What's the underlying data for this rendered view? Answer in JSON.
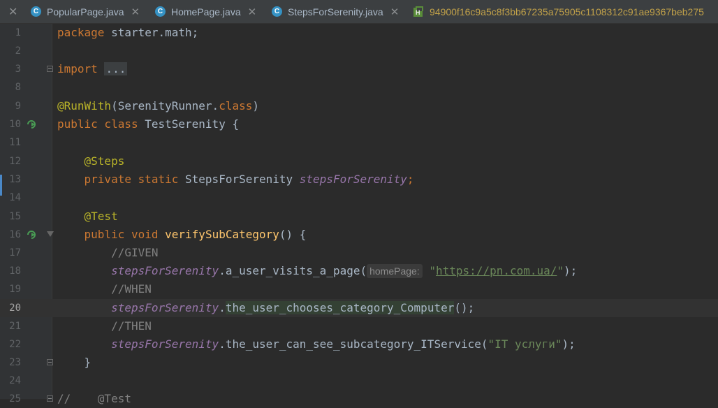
{
  "tabs": [
    {
      "label": "PopularPage.java",
      "icon": "java-class-icon"
    },
    {
      "label": "HomePage.java",
      "icon": "java-class-icon"
    },
    {
      "label": "StepsForSerenity.java",
      "icon": "java-class-icon"
    },
    {
      "label": "94900f16c9a5c8f3bb67235a75905c1108312c91ae9367beb275",
      "icon": "html-file-icon"
    }
  ],
  "editor": {
    "current_line": 20,
    "lines": [
      {
        "num": "1"
      },
      {
        "num": "2"
      },
      {
        "num": "3"
      },
      {
        "num": "8"
      },
      {
        "num": "9"
      },
      {
        "num": "10"
      },
      {
        "num": "11"
      },
      {
        "num": "12"
      },
      {
        "num": "13"
      },
      {
        "num": "14"
      },
      {
        "num": "15"
      },
      {
        "num": "16"
      },
      {
        "num": "17"
      },
      {
        "num": "18"
      },
      {
        "num": "19"
      },
      {
        "num": "20"
      },
      {
        "num": "21"
      },
      {
        "num": "22"
      },
      {
        "num": "23"
      },
      {
        "num": "24"
      },
      {
        "num": "25"
      }
    ],
    "code": {
      "l1_kw": "package",
      "l1_rest": " starter.math;",
      "l3_kw": "import",
      "l3_ellipsis": "...",
      "l9_ann": "@RunWith",
      "l9_open": "(SerenityRunner.",
      "l9_class": "class",
      "l9_close": ")",
      "l10_kw": "public class",
      "l10_rest": " TestSerenity {",
      "l12_ann": "@Steps",
      "l13_kw": "private static",
      "l13_type": " StepsForSerenity ",
      "l13_field": "stepsForSerenity",
      "l13_semi": ";",
      "l15_ann": "@Test",
      "l16_kw": "public void",
      "l16_fn": "verifySubCategory",
      "l16_rest": "() {",
      "l17_cmt": "//GIVEN",
      "l18_field": "stepsForSerenity",
      "l18_call": ".a_user_visits_a_page(",
      "l18_hint": "homePage:",
      "l18_q1": "\"",
      "l18_url": "https://pn.com.ua/",
      "l18_q2": "\"",
      "l18_end": ");",
      "l19_cmt": "//WHEN",
      "l20_field": "stepsForSerenity",
      "l20_dot": ".",
      "l20_call": "the_user_chooses_category_Computer",
      "l20_end": "();",
      "l21_cmt": "//THEN",
      "l22_field": "stepsForSerenity",
      "l22_call": ".the_user_can_see_subcategory_ITService(",
      "l22_str": "\"IT услуги\"",
      "l22_end": ");",
      "l23_brace": "}",
      "l25_cmt": "//",
      "l25_ann": "@Test"
    }
  }
}
